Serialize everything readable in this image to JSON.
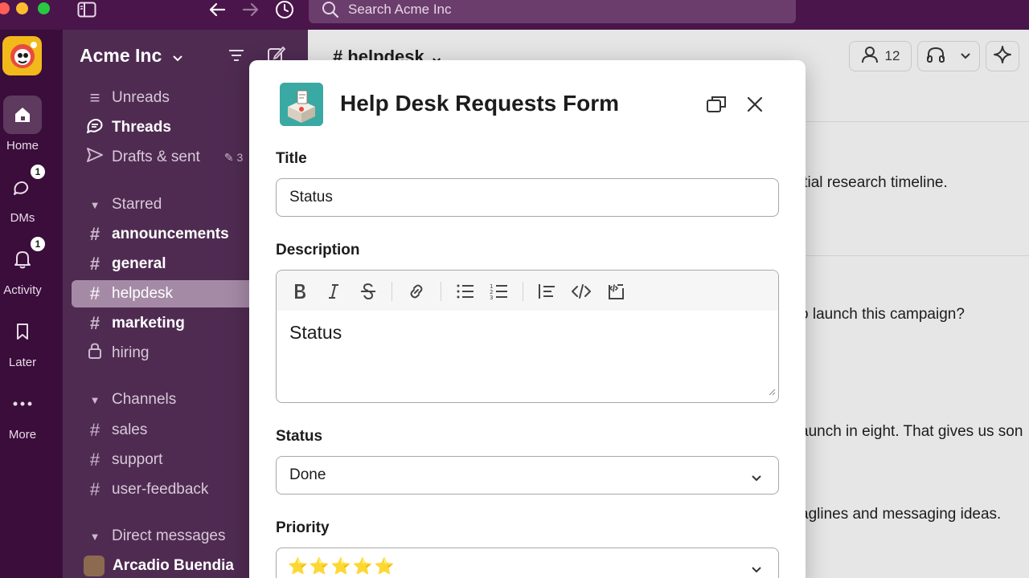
{
  "titlebar": {
    "search_placeholder": "Search Acme Inc",
    "icons": [
      "sidebar-toggle-icon",
      "back-arrow-icon",
      "forward-arrow-icon",
      "history-icon",
      "search-icon"
    ]
  },
  "rail": {
    "items": [
      {
        "label": "Home",
        "icon": "home-icon"
      },
      {
        "label": "DMs",
        "icon": "dms-icon",
        "badge": "1"
      },
      {
        "label": "Activity",
        "icon": "bell-icon",
        "badge": "1"
      },
      {
        "label": "Later",
        "icon": "bookmark-icon"
      },
      {
        "label": "More",
        "icon": "more-icon"
      }
    ]
  },
  "sidebar": {
    "workspace": "Acme Inc",
    "nav": [
      {
        "label": "Unreads",
        "icon": "unreads-icon"
      },
      {
        "label": "Threads",
        "icon": "threads-icon"
      },
      {
        "label": "Drafts & sent",
        "icon": "send-icon",
        "count": "3"
      }
    ],
    "starred_label": "Starred",
    "starred": [
      {
        "label": "announcements"
      },
      {
        "label": "general"
      },
      {
        "label": "helpdesk"
      },
      {
        "label": "marketing"
      },
      {
        "label": "hiring"
      }
    ],
    "channels_label": "Channels",
    "channels": [
      {
        "label": "sales"
      },
      {
        "label": "support"
      },
      {
        "label": "user-feedback"
      }
    ],
    "dm_label": "Direct messages",
    "dms": [
      {
        "label": "Arcadio Buendia"
      }
    ]
  },
  "channel": {
    "name": "# helpdesk",
    "member_count": "12",
    "messages": [
      "itial research timeline.",
      "o launch this campaign?",
      "aunch in eight. That gives us son",
      "aglines and messaging ideas."
    ]
  },
  "modal": {
    "title": "Help Desk Requests Form",
    "fields": {
      "title_label": "Title",
      "title_value": "Status",
      "description_label": "Description",
      "description_value": "Status",
      "status_label": "Status",
      "status_value": "Done",
      "priority_label": "Priority",
      "priority_value": "⭐⭐⭐⭐⭐"
    },
    "toolbar": [
      "bold-icon",
      "italic-icon",
      "strikethrough-icon",
      "link-icon",
      "bulleted-list-icon",
      "numbered-list-icon",
      "quote-icon",
      "code-icon",
      "code-block-icon"
    ]
  },
  "colors": {
    "aubergine": "#4a154b",
    "sidebar": "#4f2b52",
    "active_item": "#a58aa6",
    "modal_bg": "#ffffff"
  }
}
